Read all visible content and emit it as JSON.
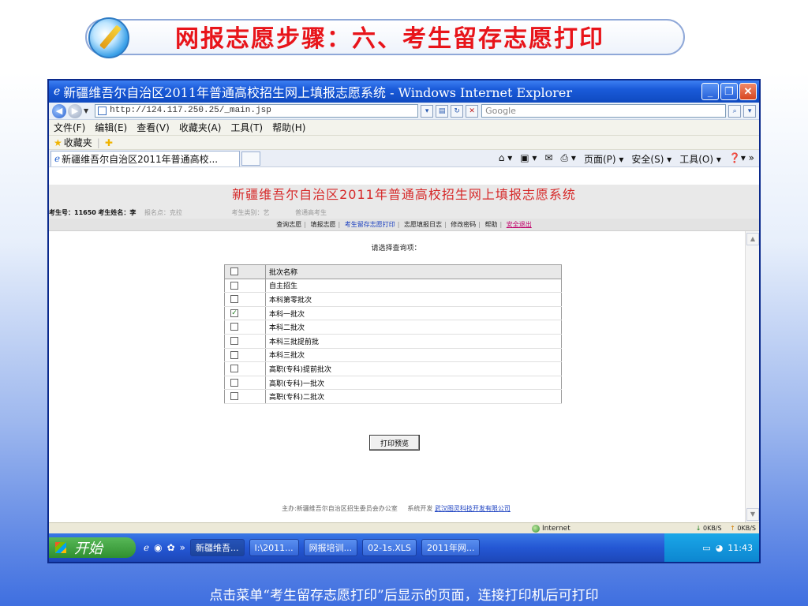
{
  "slide": {
    "title": "网报志愿步骤：六、考生留存志愿打印",
    "caption": "点击菜单“考生留存志愿打印”后显示的页面，连接打印机后可打印"
  },
  "window": {
    "title": "新疆维吾尔自治区2011年普通高校招生网上填报志愿系统 - Windows Internet Explorer",
    "address": "http://124.117.250.25/_main.jsp",
    "search_placeholder": "Google",
    "menu": [
      "文件(F)",
      "编辑(E)",
      "查看(V)",
      "收藏夹(A)",
      "工具(T)",
      "帮助(H)"
    ],
    "favorites_label": "收藏夹",
    "tab_label": "新疆维吾尔自治区2011年普通高校...",
    "command_items": [
      "页面(P) ▾",
      "安全(S) ▾",
      "工具(O) ▾"
    ]
  },
  "page": {
    "system_title": "新疆维吾尔自治区2011年普通高校招生网上填报志愿系统",
    "info": {
      "exam_no_label": "考生号：",
      "exam_no_value": "11650",
      "name_label": "考生姓名：",
      "name_value": "李",
      "site_label": "报名点：克拉",
      "type_label": "考生类别：艺",
      "type_value": "普通高考生"
    },
    "nav": [
      "查询志愿",
      "填报志愿",
      "考生留存志愿打印",
      "志愿填报日志",
      "修改密码",
      "帮助",
      "安全退出"
    ],
    "prompt": "请选择查询项：",
    "table": {
      "header": "批次名称",
      "rows": [
        {
          "name": "自主招生",
          "checked": false
        },
        {
          "name": "本科第零批次",
          "checked": false
        },
        {
          "name": "本科一批次",
          "checked": true
        },
        {
          "name": "本科二批次",
          "checked": false
        },
        {
          "name": "本科三批提前批",
          "checked": false
        },
        {
          "name": "本科三批次",
          "checked": false
        },
        {
          "name": "高职(专科)提前批次",
          "checked": false
        },
        {
          "name": "高职(专科)一批次",
          "checked": false
        },
        {
          "name": "高职(专科)二批次",
          "checked": false
        }
      ]
    },
    "print_button": "打印预览",
    "footer_host": "主办:新疆维吾尔自治区招生委员会办公室",
    "footer_dev_label": "系统开发",
    "footer_dev_link": "武汉图灵科技开发有限公司"
  },
  "status": {
    "zone": "Internet",
    "speed1": "0KB/S",
    "speed2": "0KB/S"
  },
  "taskbar": {
    "start": "开始",
    "tasks": [
      "新疆维吾...",
      "I:\\2011...",
      "网报培训...",
      "02-1s.XLS",
      "2011年网..."
    ],
    "clock": "11:43"
  }
}
